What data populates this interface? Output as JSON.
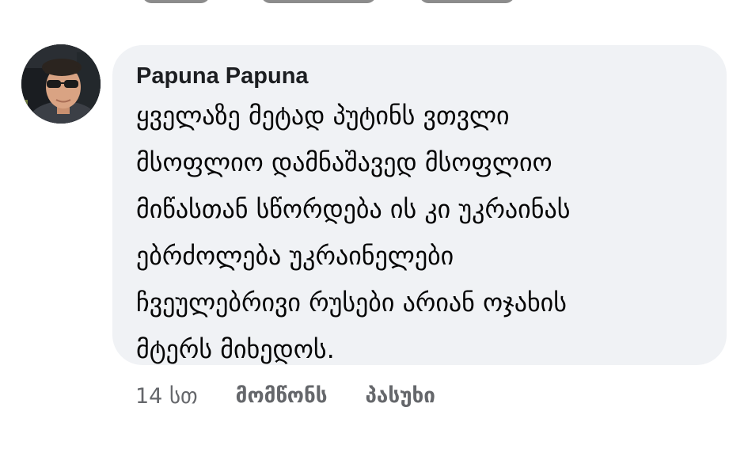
{
  "comment": {
    "author": "Papuna Papuna",
    "lines": [
      "ყველაზე მეტად პუტინს ვთვლი",
      "მსოფლიო დამნაშავედ მსოფლიო",
      "მიწასთან სწორდება ის კი უკრაინას",
      "ებრძოლება უკრაინელები",
      "ჩვეულებრივი რუსები არიან ოჯახის",
      "მტერს მიხედოს."
    ],
    "timestamp": "14 სთ",
    "like_label": "მომწონს",
    "reply_label": "პასუხი"
  },
  "colors": {
    "bubble_bg": "#f0f2f5",
    "author": "#1c1e21",
    "text": "#050505",
    "meta": "#65676b"
  },
  "icons": {
    "avatar": "profile-photo"
  }
}
